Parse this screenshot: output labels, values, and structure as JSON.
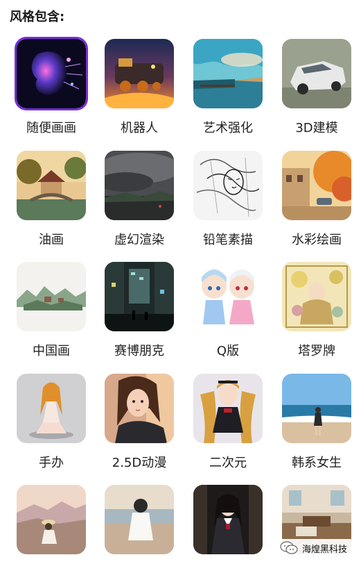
{
  "header": {
    "title": "风格包含:"
  },
  "styles": [
    {
      "label": "随便画画",
      "icon": "abstract-face-image",
      "selected": true
    },
    {
      "label": "机器人",
      "icon": "steampunk-train-image"
    },
    {
      "label": "艺术强化",
      "icon": "sea-landscape-image"
    },
    {
      "label": "3D建模",
      "icon": "3d-car-image"
    },
    {
      "label": "油画",
      "icon": "oil-painting-village-image"
    },
    {
      "label": "虚幻渲染",
      "icon": "dark-cloud-landscape-image"
    },
    {
      "label": "铅笔素描",
      "icon": "pencil-sketch-image"
    },
    {
      "label": "水彩绘画",
      "icon": "watercolor-street-image"
    },
    {
      "label": "中国画",
      "icon": "chinese-ink-landscape-image"
    },
    {
      "label": "赛博朋克",
      "icon": "cyberpunk-city-image"
    },
    {
      "label": "Q版",
      "icon": "chibi-characters-image"
    },
    {
      "label": "塔罗牌",
      "icon": "tarot-card-image"
    },
    {
      "label": "手办",
      "icon": "figurine-image"
    },
    {
      "label": "2.5D动漫",
      "icon": "anime-portrait-image"
    },
    {
      "label": "二次元",
      "icon": "anime-girl-image"
    },
    {
      "label": "韩系女生",
      "icon": "beach-girl-image"
    },
    {
      "label": "",
      "icon": "mountain-sitting-person-image"
    },
    {
      "label": "",
      "icon": "seaside-girl-image"
    },
    {
      "label": "",
      "icon": "uniform-girl-image"
    },
    {
      "label": "",
      "icon": "interior-room-image"
    }
  ],
  "watermark": {
    "text": "海煌黑科技",
    "icon": "wechat-icon"
  }
}
